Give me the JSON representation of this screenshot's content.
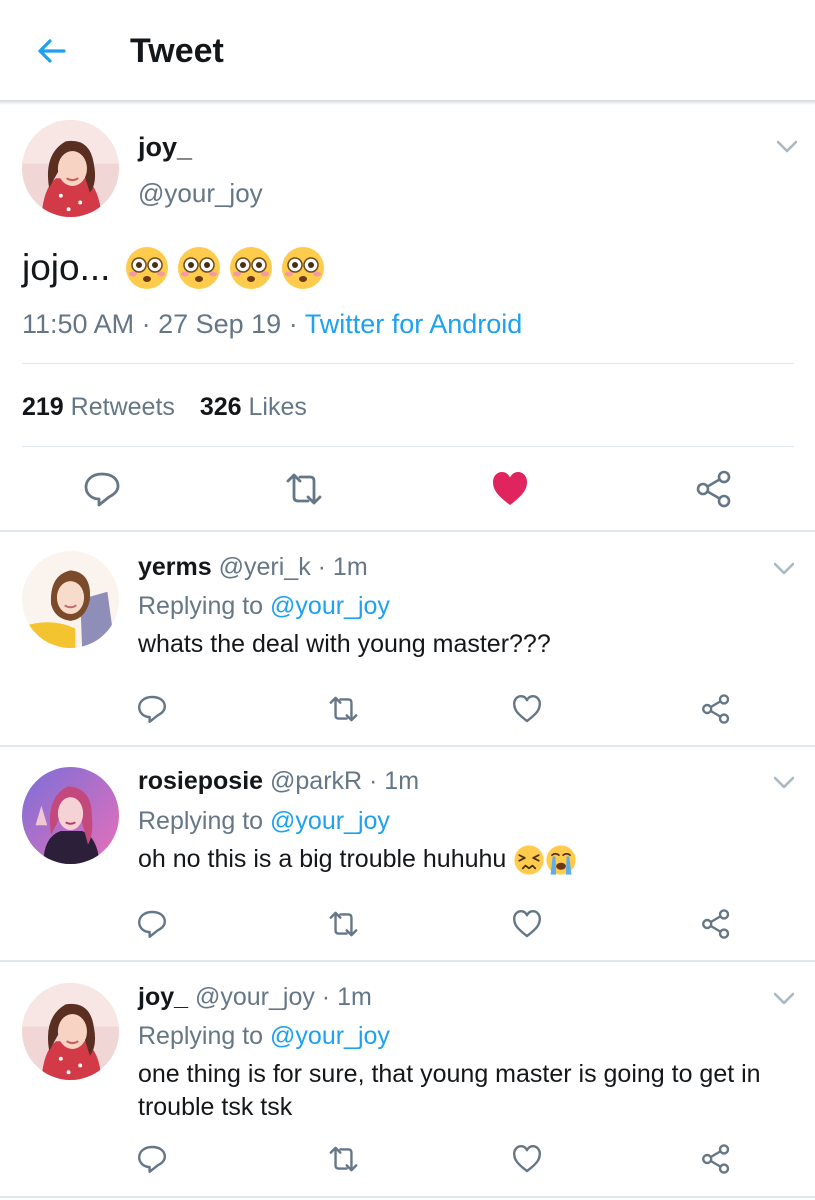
{
  "header": {
    "title": "Tweet",
    "back_icon": "arrow-left-icon",
    "accent": "#1da1f2"
  },
  "main_tweet": {
    "display_name": "joy_",
    "handle": "@your_joy",
    "text": "jojo...",
    "emoji": [
      "flushed-face",
      "flushed-face",
      "flushed-face",
      "flushed-face"
    ],
    "time": "11:50 AM",
    "sep1": " · ",
    "date": "27 Sep 19",
    "sep2": " · ",
    "source": "Twitter for Android",
    "retweet_count": "219",
    "retweet_label": "Retweets",
    "like_count": "326",
    "like_label": "Likes",
    "liked": true,
    "like_color": "#e0245e"
  },
  "replies": [
    {
      "display_name": "yerms",
      "handle": "@yeri_k",
      "time": " · 1m",
      "replying_prefix": "Replying to ",
      "replying_to": "@your_joy",
      "text": "whats the deal with young master???"
    },
    {
      "display_name": "rosieposie",
      "handle": "@parkR",
      "time": " · 1m",
      "replying_prefix": "Replying to ",
      "replying_to": "@your_joy",
      "text": "oh no this is a big trouble huhuhu ",
      "emoji": [
        "persevering-face",
        "loudly-crying-face"
      ]
    },
    {
      "display_name": "joy_",
      "handle": "@your_joy",
      "time": " · 1m",
      "replying_prefix": "Replying to ",
      "replying_to": "@your_joy",
      "text": "one thing is for sure, that young master is going to get in trouble tsk tsk"
    }
  ]
}
